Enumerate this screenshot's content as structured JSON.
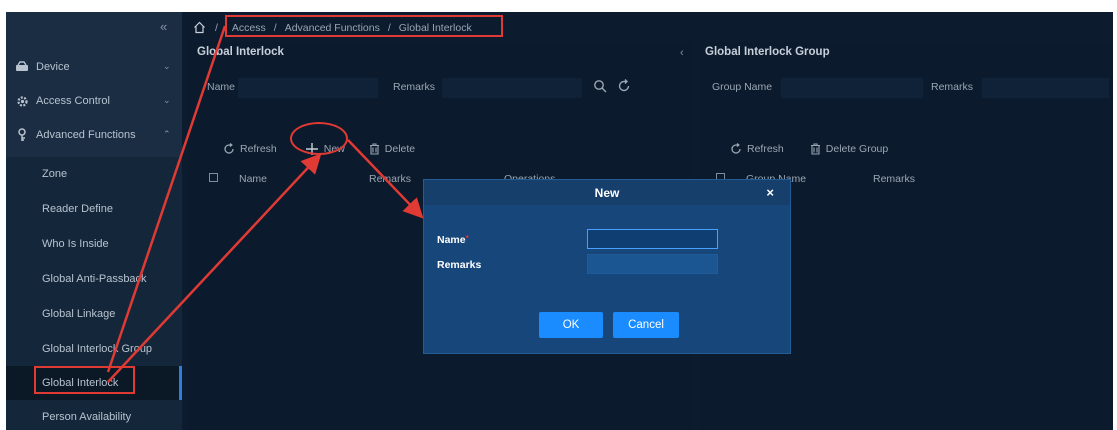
{
  "sidebar": {
    "collapse_glyph": "«",
    "groups": [
      {
        "label": "Device",
        "icon": "device-icon",
        "chevron": "⌄"
      },
      {
        "label": "Access Control",
        "icon": "gear-icon",
        "chevron": "⌄"
      },
      {
        "label": "Advanced Functions",
        "icon": "key-icon",
        "chevron": "⌃"
      }
    ],
    "sub_items": [
      {
        "label": "Zone"
      },
      {
        "label": "Reader Define"
      },
      {
        "label": "Who Is Inside"
      },
      {
        "label": "Global Anti-Passback"
      },
      {
        "label": "Global Linkage"
      },
      {
        "label": "Global Interlock Group"
      },
      {
        "label": "Global Interlock",
        "active": true
      },
      {
        "label": "Person Availability"
      }
    ]
  },
  "breadcrumb": {
    "items": [
      "Access",
      "Advanced Functions",
      "Global Interlock"
    ],
    "separator": "/"
  },
  "left_panel": {
    "title": "Global Interlock",
    "collapse_glyph": "‹",
    "filters": [
      {
        "label": "Name",
        "value": ""
      },
      {
        "label": "Remarks",
        "value": ""
      }
    ],
    "toolbar": {
      "refresh": "Refresh",
      "new": "New",
      "delete": "Delete"
    },
    "columns": [
      "Name",
      "Remarks",
      "Operations"
    ]
  },
  "right_panel": {
    "title": "Global Interlock Group",
    "filters": [
      {
        "label": "Group Name",
        "value": ""
      },
      {
        "label": "Remarks",
        "value": ""
      }
    ],
    "toolbar": {
      "refresh": "Refresh",
      "delete_group": "Delete Group"
    },
    "columns": [
      "Group Name",
      "Remarks"
    ]
  },
  "modal": {
    "title": "New",
    "close_glyph": "×",
    "fields": [
      {
        "label": "Name",
        "required_mark": "*",
        "value": ""
      },
      {
        "label": "Remarks",
        "value": ""
      }
    ],
    "ok_label": "OK",
    "cancel_label": "Cancel"
  },
  "colors": {
    "background": "#0c1b2e",
    "sidebar": "#1a2d43",
    "modal": "#16467a",
    "accent": "#1a8cff",
    "annotation": "#e03a34"
  }
}
